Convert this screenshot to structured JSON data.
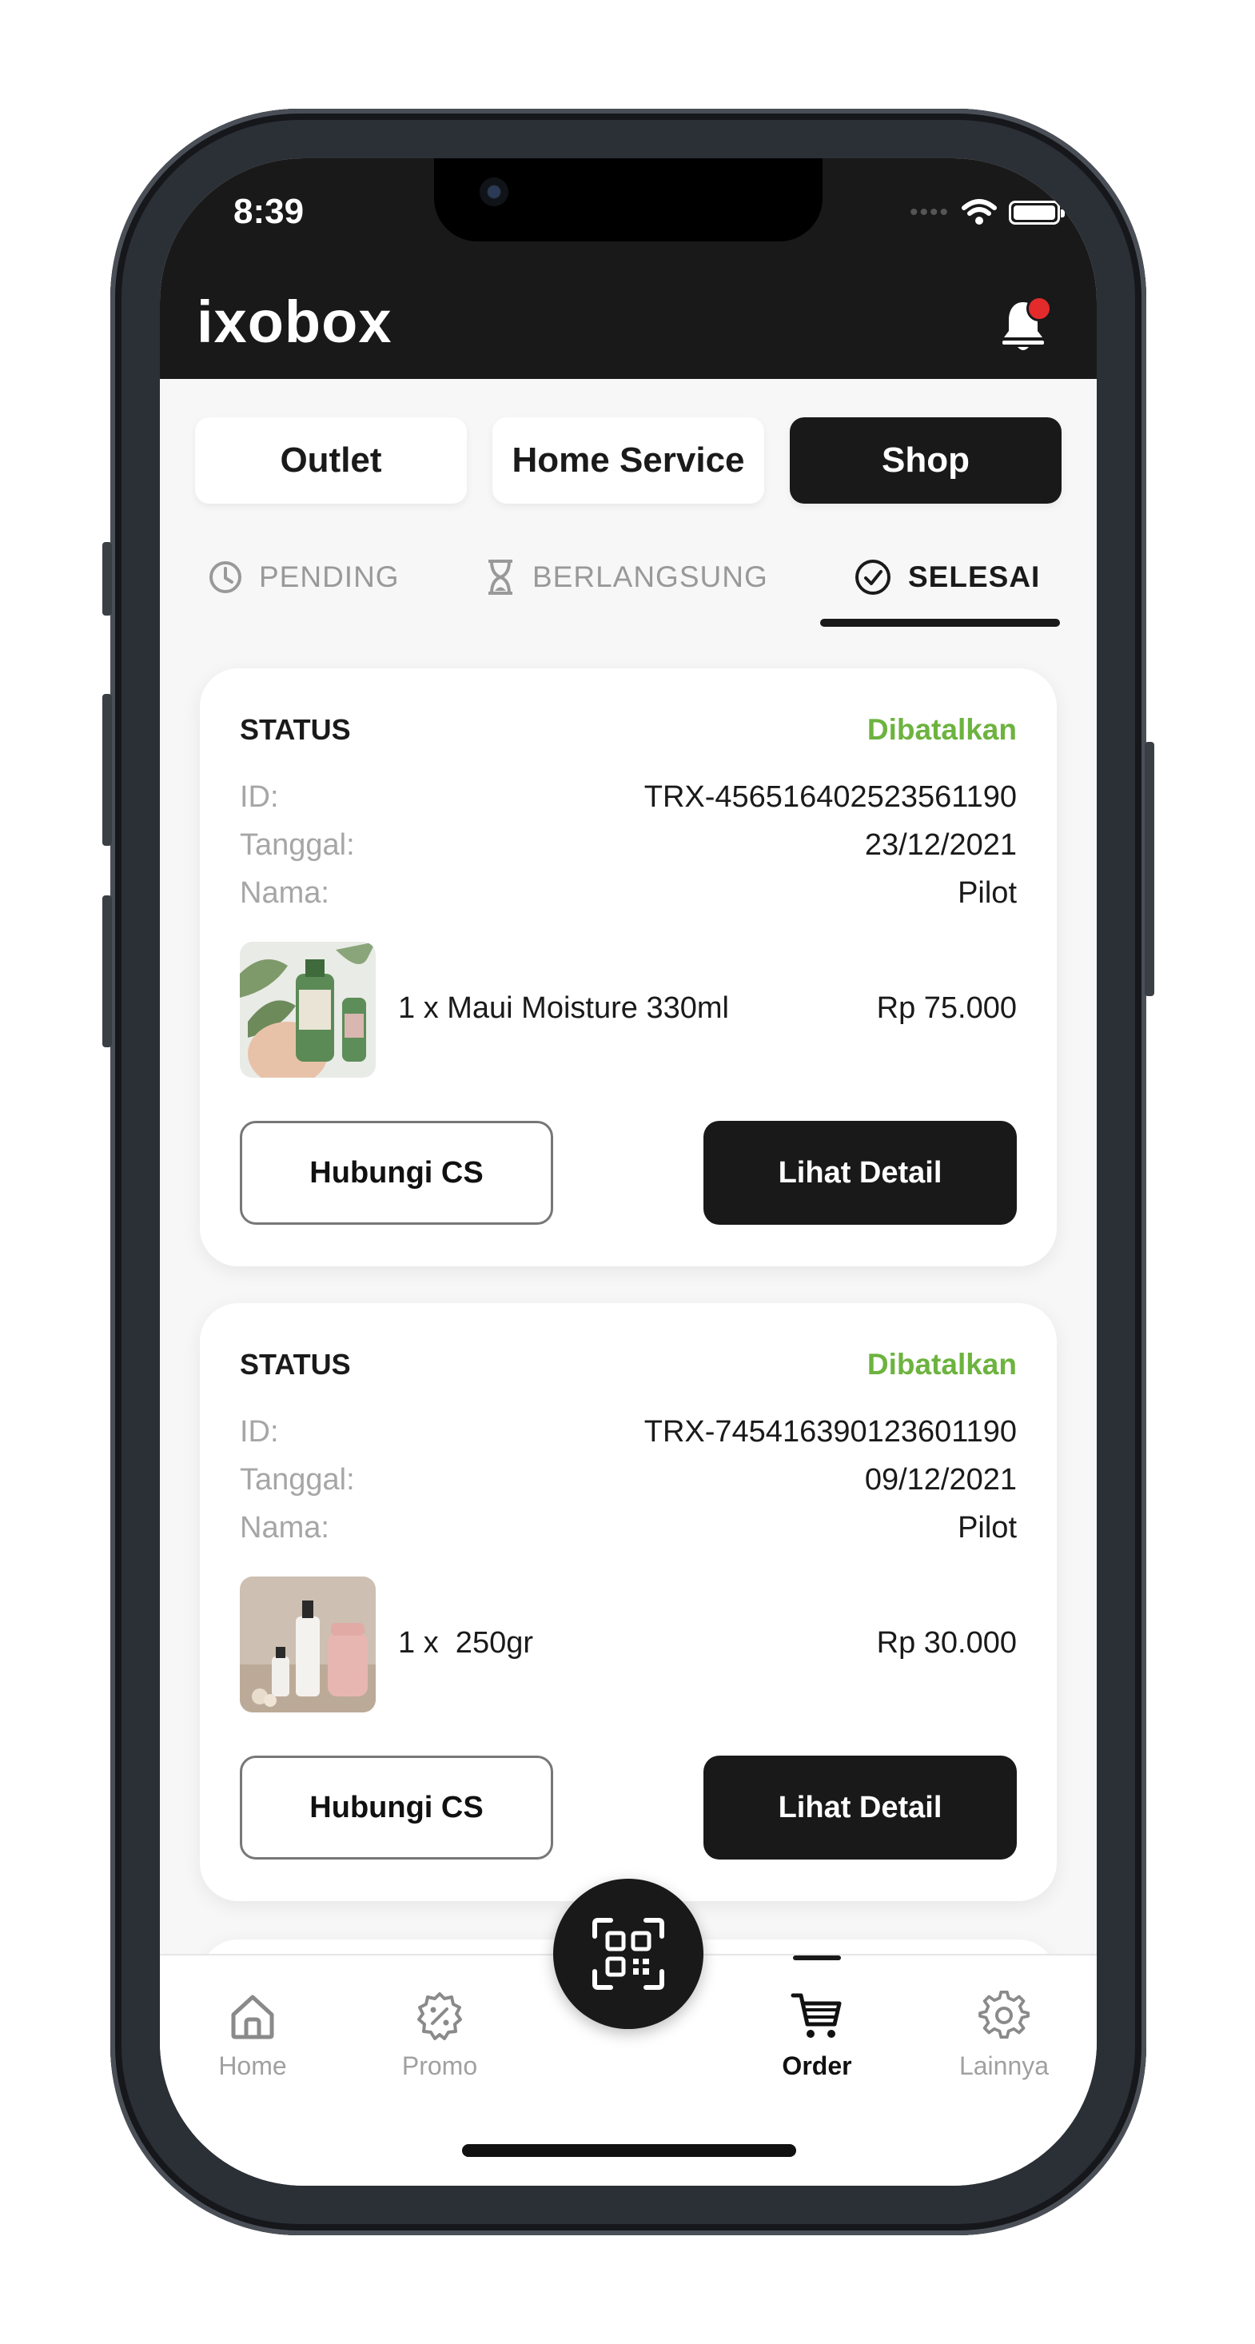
{
  "status_bar": {
    "time": "8:39"
  },
  "header": {
    "logo": "ixobox"
  },
  "categories": [
    {
      "label": "Outlet",
      "active": false
    },
    {
      "label": "Home Service",
      "active": false
    },
    {
      "label": "Shop",
      "active": true
    }
  ],
  "status_tabs": [
    {
      "label": "PENDING",
      "icon": "clock-icon",
      "active": false
    },
    {
      "label": "BERLANGSUNG",
      "icon": "hourglass-icon",
      "active": false
    },
    {
      "label": "SELESAI",
      "icon": "check-circle-icon",
      "active": true
    }
  ],
  "labels": {
    "status": "STATUS",
    "id": "ID:",
    "date": "Tanggal:",
    "name": "Nama:",
    "contact_cs": "Hubungi CS",
    "view_detail": "Lihat Detail"
  },
  "orders": [
    {
      "status": "Dibatalkan",
      "id": "TRX-456516402523561190",
      "date": "23/12/2021",
      "name": "Pilot",
      "item": "1 x Maui Moisture 330ml",
      "price": "Rp 75.000"
    },
    {
      "status": "Dibatalkan",
      "id": "TRX-745416390123601190",
      "date": "09/12/2021",
      "name": "Pilot",
      "item": "1 x  250gr",
      "price": "Rp 30.000"
    }
  ],
  "bottom_nav": [
    {
      "label": "Home",
      "icon": "home-icon",
      "active": false
    },
    {
      "label": "Promo",
      "icon": "promo-badge-icon",
      "active": false
    },
    {
      "label": "Order",
      "icon": "cart-icon",
      "active": true
    },
    {
      "label": "Lainnya",
      "icon": "gear-icon",
      "active": false
    }
  ],
  "colors": {
    "accent": "#191919",
    "status_cancelled": "#6db33f",
    "notification": "#e32b2b"
  }
}
